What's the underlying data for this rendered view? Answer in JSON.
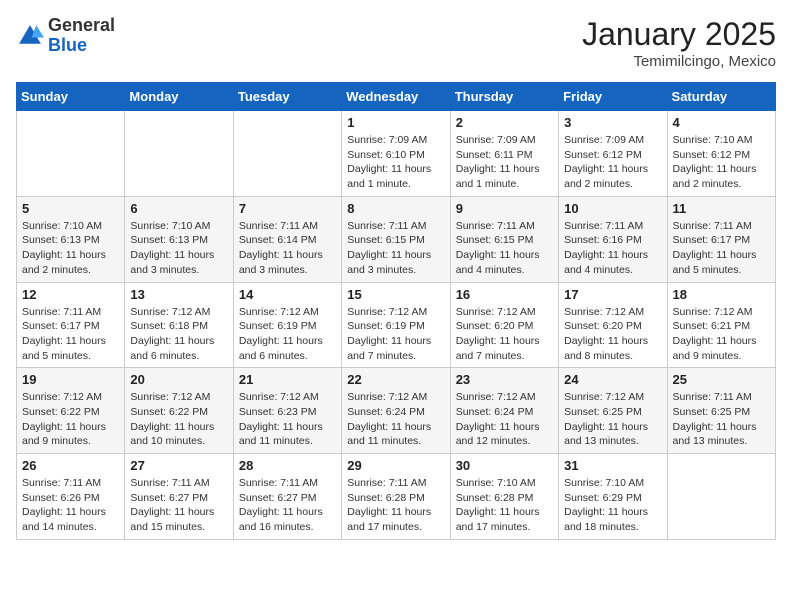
{
  "logo": {
    "general": "General",
    "blue": "Blue"
  },
  "header": {
    "month": "January 2025",
    "location": "Temimilcingo, Mexico"
  },
  "weekdays": [
    "Sunday",
    "Monday",
    "Tuesday",
    "Wednesday",
    "Thursday",
    "Friday",
    "Saturday"
  ],
  "weeks": [
    [
      {
        "day": "",
        "info": ""
      },
      {
        "day": "",
        "info": ""
      },
      {
        "day": "",
        "info": ""
      },
      {
        "day": "1",
        "info": "Sunrise: 7:09 AM\nSunset: 6:10 PM\nDaylight: 11 hours\nand 1 minute."
      },
      {
        "day": "2",
        "info": "Sunrise: 7:09 AM\nSunset: 6:11 PM\nDaylight: 11 hours\nand 1 minute."
      },
      {
        "day": "3",
        "info": "Sunrise: 7:09 AM\nSunset: 6:12 PM\nDaylight: 11 hours\nand 2 minutes."
      },
      {
        "day": "4",
        "info": "Sunrise: 7:10 AM\nSunset: 6:12 PM\nDaylight: 11 hours\nand 2 minutes."
      }
    ],
    [
      {
        "day": "5",
        "info": "Sunrise: 7:10 AM\nSunset: 6:13 PM\nDaylight: 11 hours\nand 2 minutes."
      },
      {
        "day": "6",
        "info": "Sunrise: 7:10 AM\nSunset: 6:13 PM\nDaylight: 11 hours\nand 3 minutes."
      },
      {
        "day": "7",
        "info": "Sunrise: 7:11 AM\nSunset: 6:14 PM\nDaylight: 11 hours\nand 3 minutes."
      },
      {
        "day": "8",
        "info": "Sunrise: 7:11 AM\nSunset: 6:15 PM\nDaylight: 11 hours\nand 3 minutes."
      },
      {
        "day": "9",
        "info": "Sunrise: 7:11 AM\nSunset: 6:15 PM\nDaylight: 11 hours\nand 4 minutes."
      },
      {
        "day": "10",
        "info": "Sunrise: 7:11 AM\nSunset: 6:16 PM\nDaylight: 11 hours\nand 4 minutes."
      },
      {
        "day": "11",
        "info": "Sunrise: 7:11 AM\nSunset: 6:17 PM\nDaylight: 11 hours\nand 5 minutes."
      }
    ],
    [
      {
        "day": "12",
        "info": "Sunrise: 7:11 AM\nSunset: 6:17 PM\nDaylight: 11 hours\nand 5 minutes."
      },
      {
        "day": "13",
        "info": "Sunrise: 7:12 AM\nSunset: 6:18 PM\nDaylight: 11 hours\nand 6 minutes."
      },
      {
        "day": "14",
        "info": "Sunrise: 7:12 AM\nSunset: 6:19 PM\nDaylight: 11 hours\nand 6 minutes."
      },
      {
        "day": "15",
        "info": "Sunrise: 7:12 AM\nSunset: 6:19 PM\nDaylight: 11 hours\nand 7 minutes."
      },
      {
        "day": "16",
        "info": "Sunrise: 7:12 AM\nSunset: 6:20 PM\nDaylight: 11 hours\nand 7 minutes."
      },
      {
        "day": "17",
        "info": "Sunrise: 7:12 AM\nSunset: 6:20 PM\nDaylight: 11 hours\nand 8 minutes."
      },
      {
        "day": "18",
        "info": "Sunrise: 7:12 AM\nSunset: 6:21 PM\nDaylight: 11 hours\nand 9 minutes."
      }
    ],
    [
      {
        "day": "19",
        "info": "Sunrise: 7:12 AM\nSunset: 6:22 PM\nDaylight: 11 hours\nand 9 minutes."
      },
      {
        "day": "20",
        "info": "Sunrise: 7:12 AM\nSunset: 6:22 PM\nDaylight: 11 hours\nand 10 minutes."
      },
      {
        "day": "21",
        "info": "Sunrise: 7:12 AM\nSunset: 6:23 PM\nDaylight: 11 hours\nand 11 minutes."
      },
      {
        "day": "22",
        "info": "Sunrise: 7:12 AM\nSunset: 6:24 PM\nDaylight: 11 hours\nand 11 minutes."
      },
      {
        "day": "23",
        "info": "Sunrise: 7:12 AM\nSunset: 6:24 PM\nDaylight: 11 hours\nand 12 minutes."
      },
      {
        "day": "24",
        "info": "Sunrise: 7:12 AM\nSunset: 6:25 PM\nDaylight: 11 hours\nand 13 minutes."
      },
      {
        "day": "25",
        "info": "Sunrise: 7:11 AM\nSunset: 6:25 PM\nDaylight: 11 hours\nand 13 minutes."
      }
    ],
    [
      {
        "day": "26",
        "info": "Sunrise: 7:11 AM\nSunset: 6:26 PM\nDaylight: 11 hours\nand 14 minutes."
      },
      {
        "day": "27",
        "info": "Sunrise: 7:11 AM\nSunset: 6:27 PM\nDaylight: 11 hours\nand 15 minutes."
      },
      {
        "day": "28",
        "info": "Sunrise: 7:11 AM\nSunset: 6:27 PM\nDaylight: 11 hours\nand 16 minutes."
      },
      {
        "day": "29",
        "info": "Sunrise: 7:11 AM\nSunset: 6:28 PM\nDaylight: 11 hours\nand 17 minutes."
      },
      {
        "day": "30",
        "info": "Sunrise: 7:10 AM\nSunset: 6:28 PM\nDaylight: 11 hours\nand 17 minutes."
      },
      {
        "day": "31",
        "info": "Sunrise: 7:10 AM\nSunset: 6:29 PM\nDaylight: 11 hours\nand 18 minutes."
      },
      {
        "day": "",
        "info": ""
      }
    ]
  ]
}
